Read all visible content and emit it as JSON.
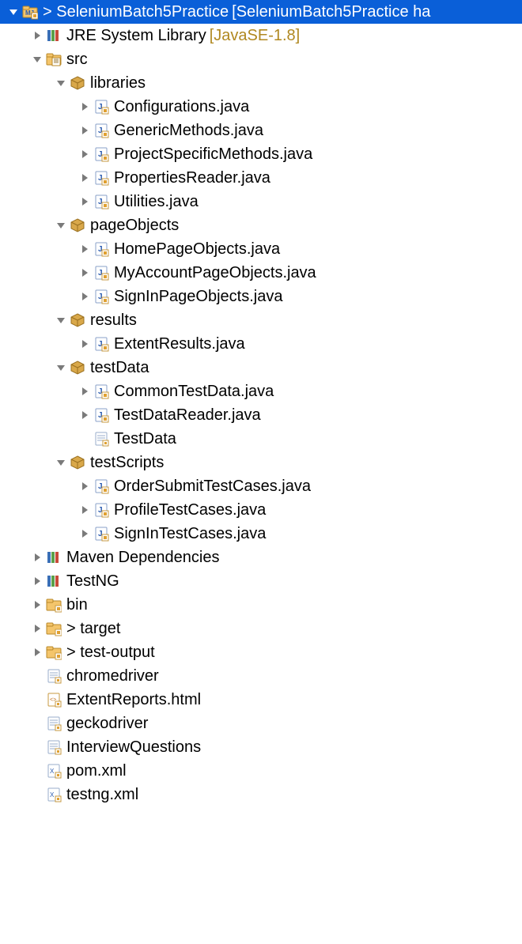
{
  "tree": [
    {
      "indent": 0,
      "arrow": "down",
      "icon": "project",
      "selected": true,
      "label": "> SeleniumBatch5Practice",
      "suffix": "[SeleniumBatch5Practice ha"
    },
    {
      "indent": 1,
      "arrow": "right",
      "icon": "library",
      "label": "JRE System Library",
      "suffix": "[JavaSE-1.8]"
    },
    {
      "indent": 1,
      "arrow": "down",
      "icon": "srcfolder",
      "label": "src"
    },
    {
      "indent": 2,
      "arrow": "down",
      "icon": "package",
      "label": "libraries"
    },
    {
      "indent": 3,
      "arrow": "right",
      "icon": "java",
      "label": "Configurations.java"
    },
    {
      "indent": 3,
      "arrow": "right",
      "icon": "java",
      "label": "GenericMethods.java"
    },
    {
      "indent": 3,
      "arrow": "right",
      "icon": "java",
      "label": "ProjectSpecificMethods.java"
    },
    {
      "indent": 3,
      "arrow": "right",
      "icon": "java",
      "label": "PropertiesReader.java"
    },
    {
      "indent": 3,
      "arrow": "right",
      "icon": "java",
      "label": "Utilities.java"
    },
    {
      "indent": 2,
      "arrow": "down",
      "icon": "package",
      "label": "pageObjects"
    },
    {
      "indent": 3,
      "arrow": "right",
      "icon": "java",
      "label": "HomePageObjects.java"
    },
    {
      "indent": 3,
      "arrow": "right",
      "icon": "java",
      "label": "MyAccountPageObjects.java"
    },
    {
      "indent": 3,
      "arrow": "right",
      "icon": "java",
      "label": "SignInPageObjects.java"
    },
    {
      "indent": 2,
      "arrow": "down",
      "icon": "package",
      "label": "results"
    },
    {
      "indent": 3,
      "arrow": "right",
      "icon": "java",
      "label": "ExtentResults.java"
    },
    {
      "indent": 2,
      "arrow": "down",
      "icon": "package",
      "label": "testData"
    },
    {
      "indent": 3,
      "arrow": "right",
      "icon": "java",
      "label": "CommonTestData.java"
    },
    {
      "indent": 3,
      "arrow": "right",
      "icon": "java",
      "label": "TestDataReader.java"
    },
    {
      "indent": 3,
      "arrow": "none",
      "icon": "file",
      "label": "TestData"
    },
    {
      "indent": 2,
      "arrow": "down",
      "icon": "package",
      "label": "testScripts"
    },
    {
      "indent": 3,
      "arrow": "right",
      "icon": "java",
      "label": "OrderSubmitTestCases.java"
    },
    {
      "indent": 3,
      "arrow": "right",
      "icon": "java",
      "label": "ProfileTestCases.java"
    },
    {
      "indent": 3,
      "arrow": "right",
      "icon": "java",
      "label": "SignInTestCases.java"
    },
    {
      "indent": 1,
      "arrow": "right",
      "icon": "library",
      "label": "Maven Dependencies"
    },
    {
      "indent": 1,
      "arrow": "right",
      "icon": "library",
      "label": "TestNG"
    },
    {
      "indent": 1,
      "arrow": "right",
      "icon": "folder",
      "label": "bin"
    },
    {
      "indent": 1,
      "arrow": "right",
      "icon": "folder",
      "label": "> target"
    },
    {
      "indent": 1,
      "arrow": "right",
      "icon": "folder",
      "label": "> test-output"
    },
    {
      "indent": 1,
      "arrow": "none",
      "icon": "file",
      "label": "chromedriver"
    },
    {
      "indent": 1,
      "arrow": "none",
      "icon": "html",
      "label": "ExtentReports.html"
    },
    {
      "indent": 1,
      "arrow": "none",
      "icon": "file",
      "label": "geckodriver"
    },
    {
      "indent": 1,
      "arrow": "none",
      "icon": "file",
      "label": "InterviewQuestions"
    },
    {
      "indent": 1,
      "arrow": "none",
      "icon": "xml",
      "label": "pom.xml"
    },
    {
      "indent": 1,
      "arrow": "none",
      "icon": "xml",
      "label": "testng.xml"
    }
  ]
}
